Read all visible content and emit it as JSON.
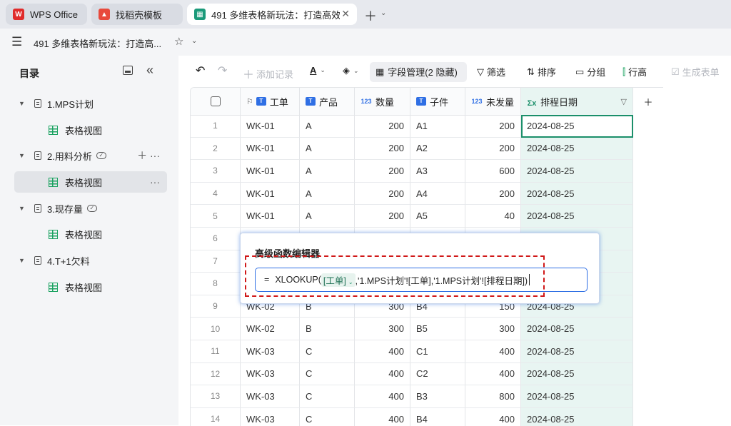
{
  "tabs": [
    {
      "label": "WPS Office",
      "icon": "wps-logo-icon",
      "active": false
    },
    {
      "label": "找稻壳模板",
      "icon": "docer-icon",
      "active": false
    },
    {
      "label": "491 多维表格新玩法：打造高效自",
      "icon": "multidim-table-icon",
      "active": true
    }
  ],
  "title_bar": {
    "doc_title": "491 多维表格新玩法：打造高..."
  },
  "sidebar": {
    "heading": "目录",
    "items": [
      {
        "label": "1.MPS计划",
        "type": "table"
      },
      {
        "label": "表格视图",
        "type": "view"
      },
      {
        "label": "2.用料分析",
        "type": "table"
      },
      {
        "label": "表格视图",
        "type": "view",
        "selected": true
      },
      {
        "label": "3.现存量",
        "type": "table"
      },
      {
        "label": "表格视图",
        "type": "view"
      },
      {
        "label": "4.T+1欠料",
        "type": "table"
      },
      {
        "label": "表格视图",
        "type": "view"
      }
    ]
  },
  "toolbar": {
    "add_record": "添加记录",
    "field_manage": "字段管理(2 隐藏)",
    "filter": "筛选",
    "sort": "排序",
    "group": "分组",
    "row_height": "行高",
    "generate_form": "生成表单"
  },
  "table": {
    "columns": [
      "工单",
      "产品",
      "数量",
      "子件",
      "未发量",
      "排程日期"
    ],
    "rows": [
      [
        "1",
        "WK-01",
        "A",
        "200",
        "A1",
        "200",
        "2024-08-25"
      ],
      [
        "2",
        "WK-01",
        "A",
        "200",
        "A2",
        "200",
        "2024-08-25"
      ],
      [
        "3",
        "WK-01",
        "A",
        "200",
        "A3",
        "600",
        "2024-08-25"
      ],
      [
        "4",
        "WK-01",
        "A",
        "200",
        "A4",
        "200",
        "2024-08-25"
      ],
      [
        "5",
        "WK-01",
        "A",
        "200",
        "A5",
        "40",
        "2024-08-25"
      ],
      [
        "6",
        "",
        "",
        "",
        "",
        "",
        ""
      ],
      [
        "7",
        "",
        "",
        "",
        "",
        "",
        ""
      ],
      [
        "8",
        "",
        "",
        "",
        "",
        "",
        ""
      ],
      [
        "9",
        "WK-02",
        "B",
        "300",
        "B4",
        "150",
        "2024-08-25"
      ],
      [
        "10",
        "WK-02",
        "B",
        "300",
        "B5",
        "300",
        "2024-08-25"
      ],
      [
        "11",
        "WK-03",
        "C",
        "400",
        "C1",
        "400",
        "2024-08-25"
      ],
      [
        "12",
        "WK-03",
        "C",
        "400",
        "C2",
        "400",
        "2024-08-25"
      ],
      [
        "13",
        "WK-03",
        "C",
        "400",
        "B3",
        "800",
        "2024-08-25"
      ],
      [
        "14",
        "WK-03",
        "C",
        "400",
        "B4",
        "400",
        "2024-08-25"
      ]
    ]
  },
  "formula_editor": {
    "title": "高级函数编辑器",
    "eq": "=",
    "func": "XLOOKUP(",
    "token": "[工单]",
    "rest": ",'1.MPS计划'![工单],'1.MPS计划'![排程日期])"
  },
  "colors": {
    "accent": "#2f6fe4",
    "formula_col": "#e8f5f2",
    "highlight": "#d01818",
    "green": "#1aa260"
  }
}
